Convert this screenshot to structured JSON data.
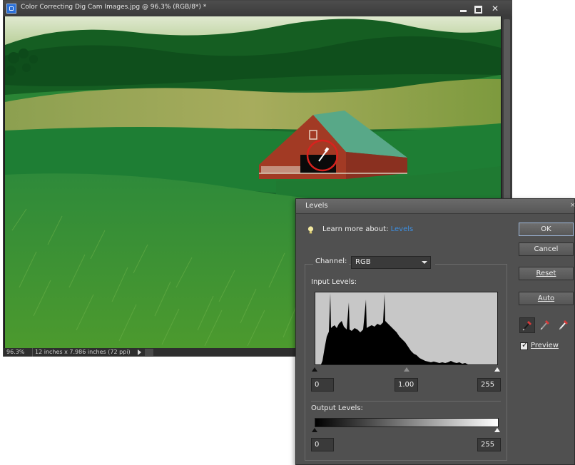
{
  "document": {
    "title": "Color Correcting Dig Cam Images.jpg @ 96.3% (RGB/8*) *",
    "zoom": "96.3%",
    "dimensions": "12 inches x 7.986 inches (72 ppi)"
  },
  "levels": {
    "title": "Levels",
    "learn_more_text": "Learn more about:",
    "learn_more_link": "Levels",
    "channel_label": "Channel:",
    "channel_value": "RGB",
    "input_levels_label": "Input Levels:",
    "input_black": "0",
    "input_gamma": "1.00",
    "input_white": "255",
    "output_levels_label": "Output Levels:",
    "output_black": "0",
    "output_white": "255",
    "preview_label": "Preview",
    "preview_checked": true
  },
  "buttons": {
    "ok": "OK",
    "cancel": "Cancel",
    "reset": "Reset",
    "auto": "Auto"
  },
  "icons": {
    "tip": "lightbulb-icon",
    "black_eyedropper": "black-eyedropper-icon",
    "gray_eyedropper": "gray-eyedropper-icon",
    "white_eyedropper": "white-eyedropper-icon"
  },
  "colors": {
    "link": "#3d8fe2",
    "dialog_bg": "#505050",
    "ok_focus": "#9db6d8"
  }
}
